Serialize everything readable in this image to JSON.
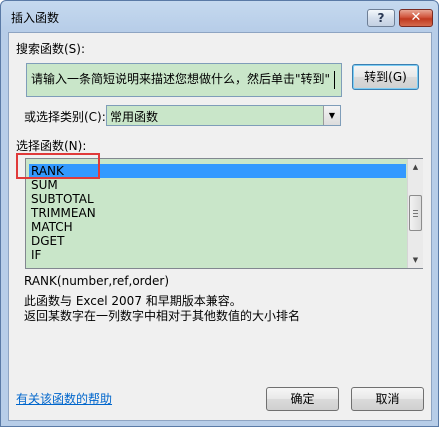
{
  "window": {
    "title": "插入函数",
    "help_glyph": "?",
    "close_glyph": "✕"
  },
  "search": {
    "label": "搜索函数(S):",
    "value": "请输入一条简短说明来描述您想做什么，然后单击\"转到\"",
    "goto_label": "转到(G)"
  },
  "category": {
    "label": "或选择类别(C):",
    "value": "常用函数"
  },
  "functions": {
    "label": "选择函数(N):",
    "items": [
      "RANK",
      "SUM",
      "SUBTOTAL",
      "TRIMMEAN",
      "MATCH",
      "DGET",
      "IF"
    ],
    "selected_index": 0
  },
  "description": {
    "signature": "RANK(number,ref,order)",
    "line1": "此函数与 Excel 2007 和早期版本兼容。",
    "line2": "返回某数字在一列数字中相对于其他数值的大小排名"
  },
  "footer": {
    "help_link": "有关该函数的帮助",
    "ok_label": "确定",
    "cancel_label": "取消"
  },
  "icons": {
    "dropdown": "chevron-down-icon",
    "scroll_up": "scroll-up-icon",
    "scroll_down": "scroll-down-icon"
  },
  "colors": {
    "field_background": "#c9e6c9",
    "selection": "#3399ff",
    "annotation": "#e03a3a",
    "link": "#0066cc"
  }
}
